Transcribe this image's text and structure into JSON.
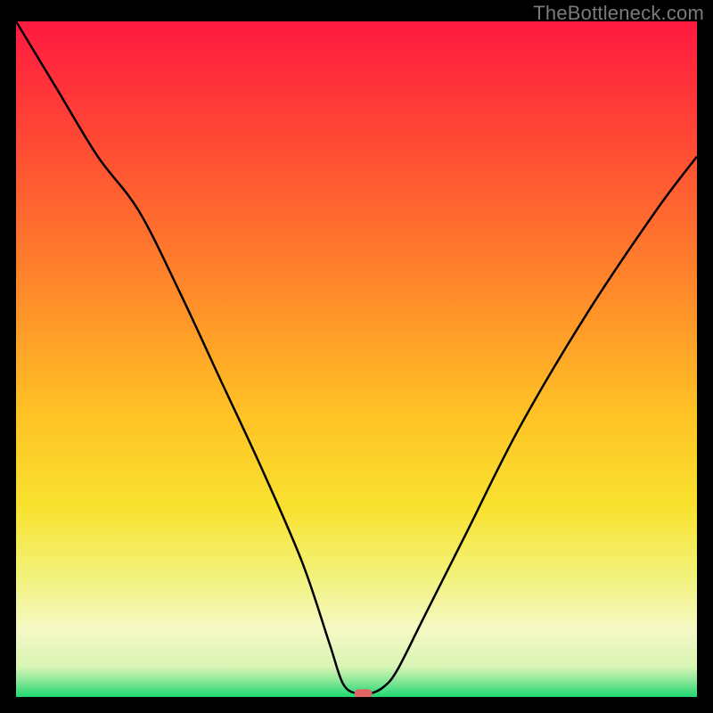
{
  "watermark": "TheBottleneck.com",
  "chart_data": {
    "type": "line",
    "title": "",
    "xlabel": "",
    "ylabel": "",
    "xlim": [
      0,
      100
    ],
    "ylim": [
      0,
      100
    ],
    "background_gradient_stops": [
      {
        "offset": 0.0,
        "color": "#ff1940"
      },
      {
        "offset": 0.18,
        "color": "#ff4a34"
      },
      {
        "offset": 0.4,
        "color": "#ff8a2a"
      },
      {
        "offset": 0.58,
        "color": "#ffc225"
      },
      {
        "offset": 0.72,
        "color": "#f9e22f"
      },
      {
        "offset": 0.82,
        "color": "#f2f27a"
      },
      {
        "offset": 0.9,
        "color": "#f5f8c4"
      },
      {
        "offset": 0.955,
        "color": "#d9f5b5"
      },
      {
        "offset": 0.975,
        "color": "#8ee89a"
      },
      {
        "offset": 1.0,
        "color": "#1fd872"
      }
    ],
    "series": [
      {
        "name": "bottleneck-curve",
        "x": [
          0,
          6,
          12,
          18,
          24,
          30,
          36,
          42,
          46,
          48,
          50,
          52,
          54,
          56,
          60,
          66,
          74,
          84,
          94,
          100
        ],
        "y": [
          100,
          90,
          80,
          72,
          60,
          47,
          34,
          20,
          8,
          2,
          0.5,
          0.5,
          1.5,
          4,
          12,
          24,
          40,
          57,
          72,
          80
        ]
      }
    ],
    "min_marker": {
      "x": 51,
      "y": 0.5
    }
  }
}
